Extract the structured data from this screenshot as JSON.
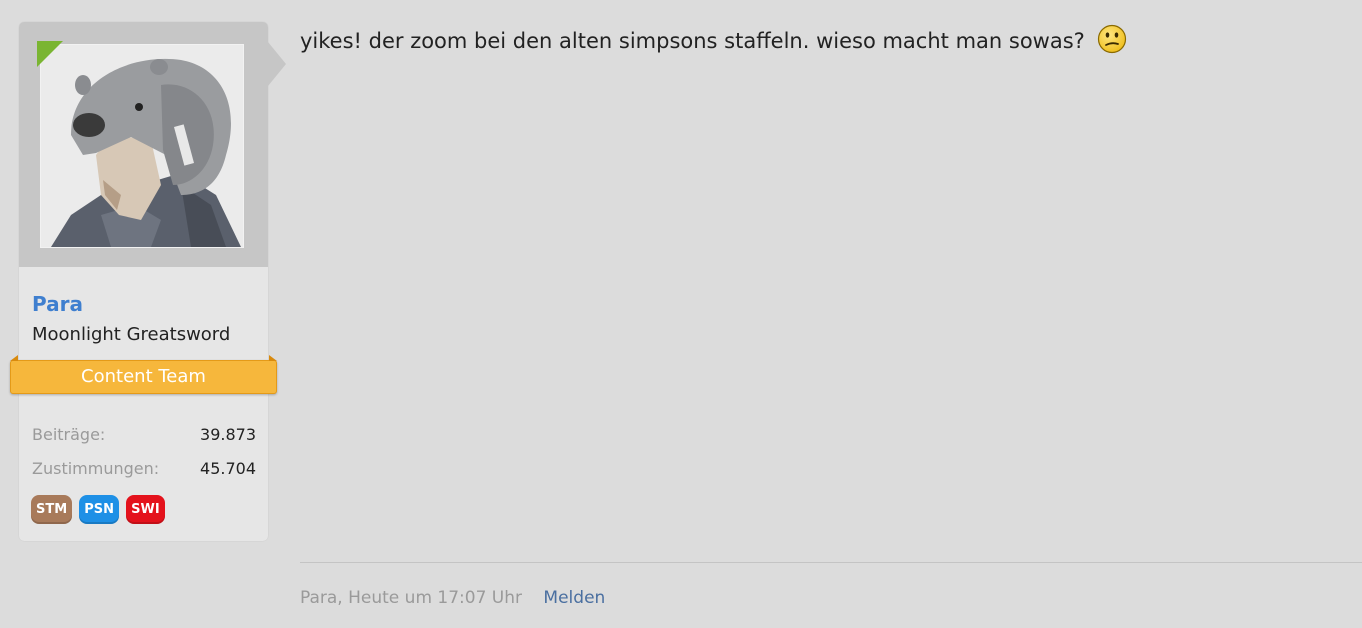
{
  "user": {
    "name": "Para",
    "title": "Moonlight Greatsword",
    "banner": "Content Team",
    "stats": [
      {
        "label": "Beiträge:",
        "value": "39.873"
      },
      {
        "label": "Zustimmungen:",
        "value": "45.704"
      }
    ],
    "badges": [
      {
        "label": "STM",
        "color": "#a87a5a"
      },
      {
        "label": "PSN",
        "color": "#1e90e6"
      },
      {
        "label": "SWI",
        "color": "#e4121c"
      }
    ],
    "online_color": "#7ab532"
  },
  "post": {
    "text": "yikes! der zoom bei den alten simpsons staffeln. wieso macht man sowas?",
    "smiley_icon": "confused-smiley-icon",
    "meta": {
      "author_time": "Para, Heute um 17:07 Uhr",
      "report": "Melden"
    }
  },
  "colors": {
    "background": "#dcdcdc",
    "username": "#3f7fcf",
    "banner": "#f6b73c",
    "link": "#4a6fa0"
  }
}
